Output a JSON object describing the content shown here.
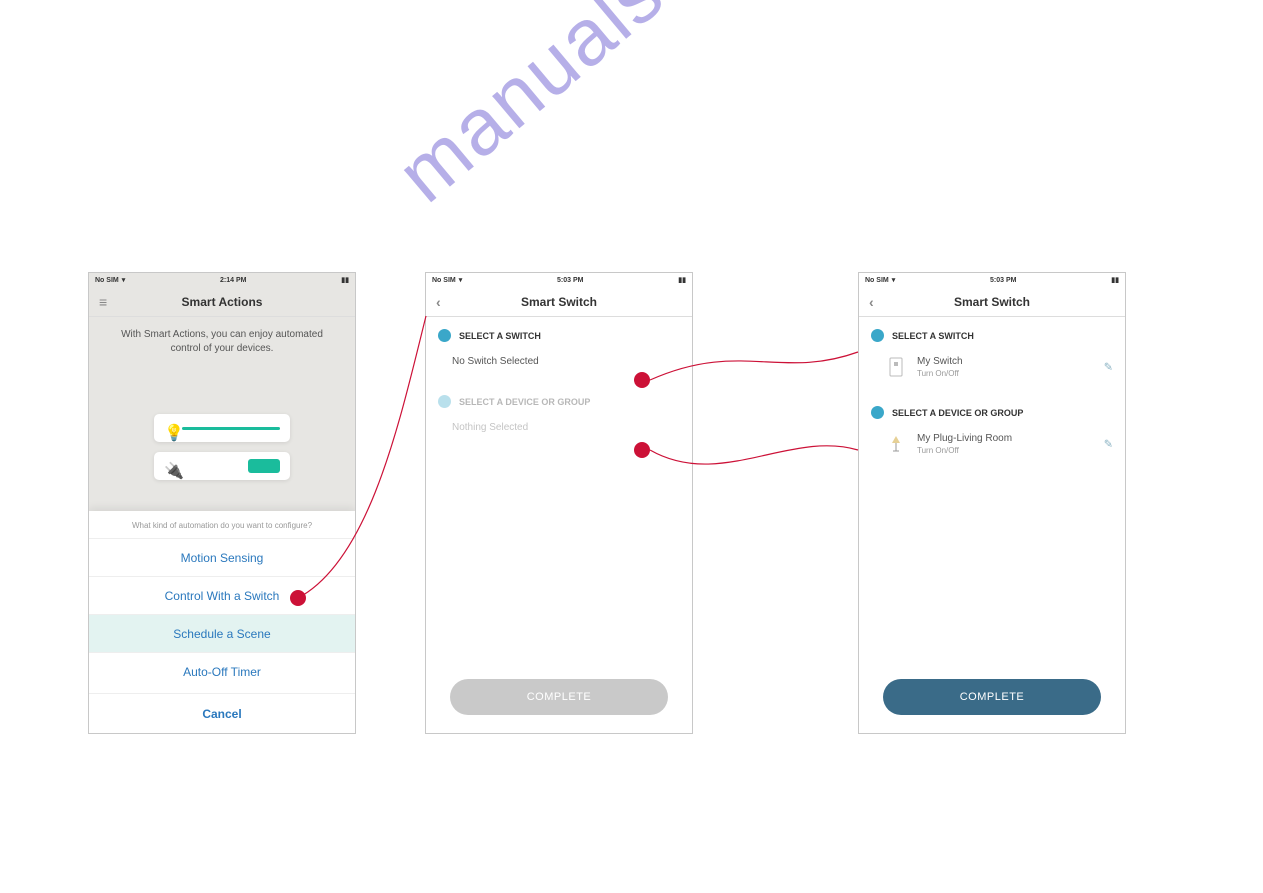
{
  "statusbar": {
    "carrier": "No SIM",
    "time1": "2:14 PM",
    "time2": "5:03 PM",
    "time3": "5:03 PM"
  },
  "screen1": {
    "title": "Smart Actions",
    "description": "With Smart Actions, you can enjoy automated control of your devices.",
    "sheet_prompt": "What kind of automation do you want to configure?",
    "options": {
      "motion": "Motion Sensing",
      "switch": "Control With a Switch",
      "schedule": "Schedule a Scene",
      "autooff": "Auto-Off Timer"
    },
    "cancel": "Cancel"
  },
  "screen2": {
    "title": "Smart Switch",
    "section1": "SELECT A SWITCH",
    "row1": "No Switch Selected",
    "section2": "SELECT A DEVICE OR GROUP",
    "row2": "Nothing Selected",
    "complete": "COMPLETE"
  },
  "screen3": {
    "title": "Smart Switch",
    "section1": "SELECT A SWITCH",
    "row1_name": "My Switch",
    "row1_action": "Turn On/Off",
    "section2": "SELECT A DEVICE OR GROUP",
    "row2_name": "My Plug-Living Room",
    "row2_action": "Turn On/Off",
    "complete": "COMPLETE"
  },
  "watermark": "manualshive.com"
}
